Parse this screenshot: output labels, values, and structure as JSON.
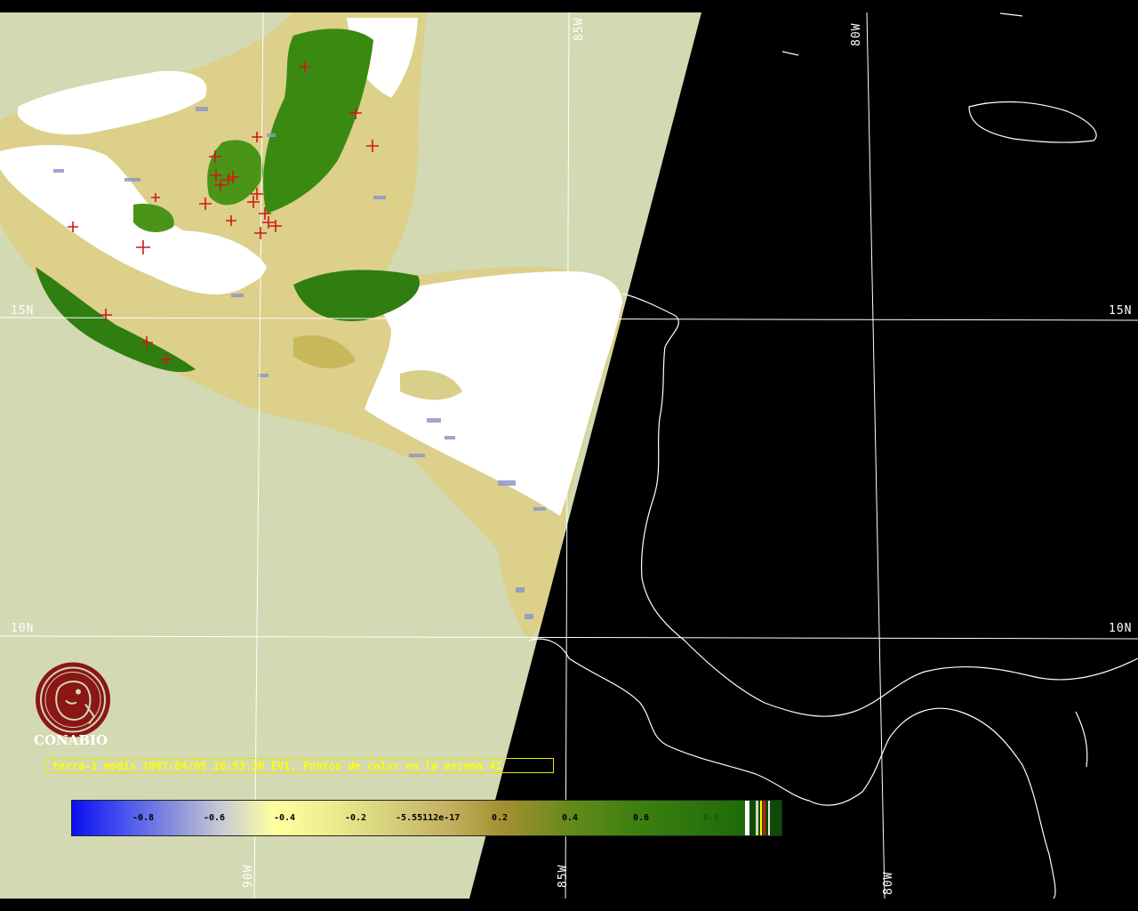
{
  "map": {
    "grid_labels": {
      "lat_15_left": "15N",
      "lat_15_right": "15N",
      "lat_10_left": "10N",
      "lat_10_right": "10N",
      "lon_85_top": "85W",
      "lon_80_top": "80W",
      "lon_90_bottom": "90W",
      "lon_85_bottom": "85W",
      "lon_80_bottom": "80W"
    },
    "colors": {
      "no_data": "#d3d9b2",
      "cloud": "#ffffff",
      "night": "#000000",
      "coastline": "#ffffff",
      "grid": "#ffffff",
      "vegetation_high": "#3a8a12",
      "vegetation_mid": "#c8c070",
      "water_low": "#8c96c8",
      "fire_point": "#d01818"
    },
    "fire_points_count": 41
  },
  "caption": {
    "text": "terra-1 modis 2007/04/05 16:53:30 EVI, Puntos de calor en la escena 41"
  },
  "logo": {
    "name": "CONABIO"
  },
  "legend": {
    "ticks": [
      "-0.8",
      "-0.6",
      "-0.4",
      "-0.2",
      "-5.55112e-17",
      "0.2",
      "0.4",
      "0.6",
      "0.8"
    ]
  }
}
